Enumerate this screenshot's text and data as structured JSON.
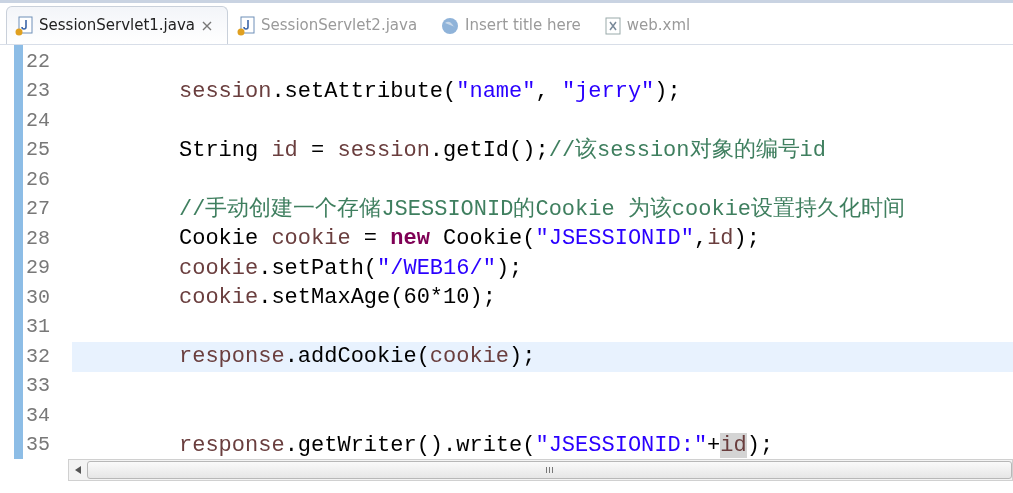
{
  "tabs": [
    {
      "label": "SessionServlet1.java",
      "kind": "java",
      "selected": true,
      "closable": true
    },
    {
      "label": "SessionServlet2.java",
      "kind": "java",
      "selected": false,
      "closable": false
    },
    {
      "label": "Insert title here",
      "kind": "web",
      "selected": false,
      "closable": false
    },
    {
      "label": "web.xml",
      "kind": "xml",
      "selected": false,
      "closable": false
    }
  ],
  "editor": {
    "lines": [
      {
        "number": "22",
        "current": false
      },
      {
        "number": "23",
        "current": false,
        "tokens": [
          {
            "text": "session",
            "kind": "var"
          },
          {
            "text": ".setAttribute(",
            "kind": "plain"
          },
          {
            "text": "\"name\"",
            "kind": "string"
          },
          {
            "text": ", ",
            "kind": "plain"
          },
          {
            "text": "\"jerry\"",
            "kind": "string"
          },
          {
            "text": ");",
            "kind": "plain"
          }
        ]
      },
      {
        "number": "24",
        "current": false
      },
      {
        "number": "25",
        "current": false,
        "tokens": [
          {
            "text": "String ",
            "kind": "plain"
          },
          {
            "text": "id",
            "kind": "var"
          },
          {
            "text": " = ",
            "kind": "plain"
          },
          {
            "text": "session",
            "kind": "var"
          },
          {
            "text": ".getId();",
            "kind": "plain"
          },
          {
            "text": "//该session对象的编号id",
            "kind": "comment"
          }
        ]
      },
      {
        "number": "26",
        "current": false
      },
      {
        "number": "27",
        "current": false,
        "tokens": [
          {
            "text": "//手动创建一个存储JSESSIONID的Cookie 为该cookie设置持久化时间",
            "kind": "comment"
          }
        ]
      },
      {
        "number": "28",
        "current": false,
        "tokens": [
          {
            "text": "Cookie ",
            "kind": "plain"
          },
          {
            "text": "cookie",
            "kind": "var"
          },
          {
            "text": " = ",
            "kind": "plain"
          },
          {
            "text": "new",
            "kind": "keyword"
          },
          {
            "text": " Cookie(",
            "kind": "plain"
          },
          {
            "text": "\"JSESSIONID\"",
            "kind": "string"
          },
          {
            "text": ",",
            "kind": "plain"
          },
          {
            "text": "id",
            "kind": "var"
          },
          {
            "text": ");",
            "kind": "plain"
          }
        ]
      },
      {
        "number": "29",
        "current": false,
        "tokens": [
          {
            "text": "cookie",
            "kind": "var"
          },
          {
            "text": ".setPath(",
            "kind": "plain"
          },
          {
            "text": "\"/WEB16/\"",
            "kind": "string"
          },
          {
            "text": ");",
            "kind": "plain"
          }
        ]
      },
      {
        "number": "30",
        "current": false,
        "tokens": [
          {
            "text": "cookie",
            "kind": "var"
          },
          {
            "text": ".setMaxAge(60*10);",
            "kind": "plain"
          }
        ]
      },
      {
        "number": "31",
        "current": false
      },
      {
        "number": "32",
        "current": true,
        "tokens": [
          {
            "text": "response",
            "kind": "var"
          },
          {
            "text": ".addCookie(",
            "kind": "plain"
          },
          {
            "text": "cookie",
            "kind": "var"
          },
          {
            "text": ");",
            "kind": "plain"
          }
        ]
      },
      {
        "number": "33",
        "current": false
      },
      {
        "number": "34",
        "current": false
      },
      {
        "number": "35",
        "current": false,
        "tokens": [
          {
            "text": "response",
            "kind": "var"
          },
          {
            "text": ".getWriter().write(",
            "kind": "plain"
          },
          {
            "text": "\"JSESSIONID:\"",
            "kind": "string"
          },
          {
            "text": "+",
            "kind": "plain"
          },
          {
            "text": "id",
            "kind": "marked"
          },
          {
            "text": ");",
            "kind": "plain"
          }
        ]
      }
    ]
  }
}
